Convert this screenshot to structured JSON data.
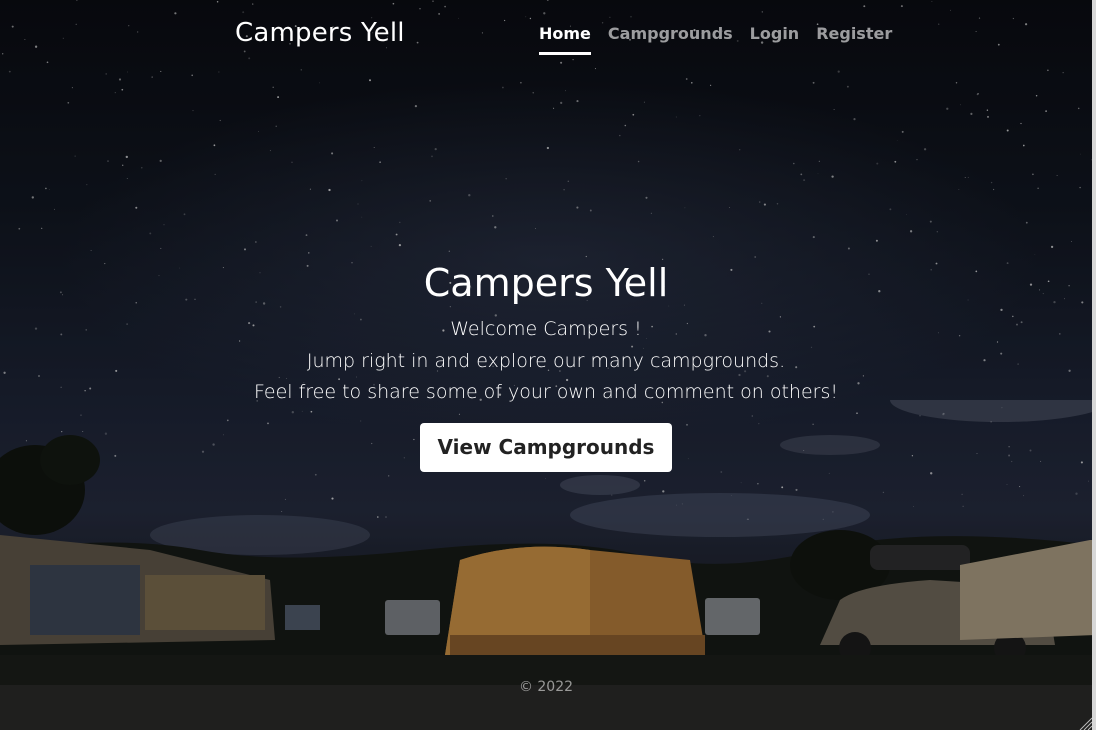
{
  "header": {
    "brand": "Campers Yell",
    "nav": [
      {
        "label": "Home",
        "active": true
      },
      {
        "label": "Campgrounds",
        "active": false
      },
      {
        "label": "Login",
        "active": false
      },
      {
        "label": "Register",
        "active": false
      }
    ]
  },
  "main": {
    "title": "Campers Yell",
    "lines": [
      "Welcome Campers !",
      "Jump right in and explore our many campgrounds.",
      "Feel free to share some of your own and comment on others!"
    ],
    "cta_label": "View Campgrounds"
  },
  "footer": {
    "text": "© 2022"
  },
  "colors": {
    "text": "#ffffff",
    "nav_muted": "rgba(255,255,255,0.6)",
    "button_bg": "#ffffff",
    "button_text": "#222222"
  }
}
